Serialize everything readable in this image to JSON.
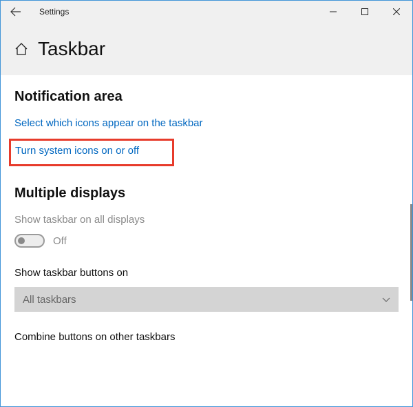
{
  "window": {
    "title": "Settings",
    "page_title": "Taskbar"
  },
  "sections": {
    "notification_area": {
      "title": "Notification area",
      "link_icons": "Select which icons appear on the taskbar",
      "link_system": "Turn system icons on or off"
    },
    "multiple_displays": {
      "title": "Multiple displays",
      "show_all": {
        "label": "Show taskbar on all displays",
        "state": "Off"
      },
      "show_buttons": {
        "label": "Show taskbar buttons on",
        "value": "All taskbars"
      },
      "combine": {
        "label": "Combine buttons on other taskbars"
      }
    }
  }
}
